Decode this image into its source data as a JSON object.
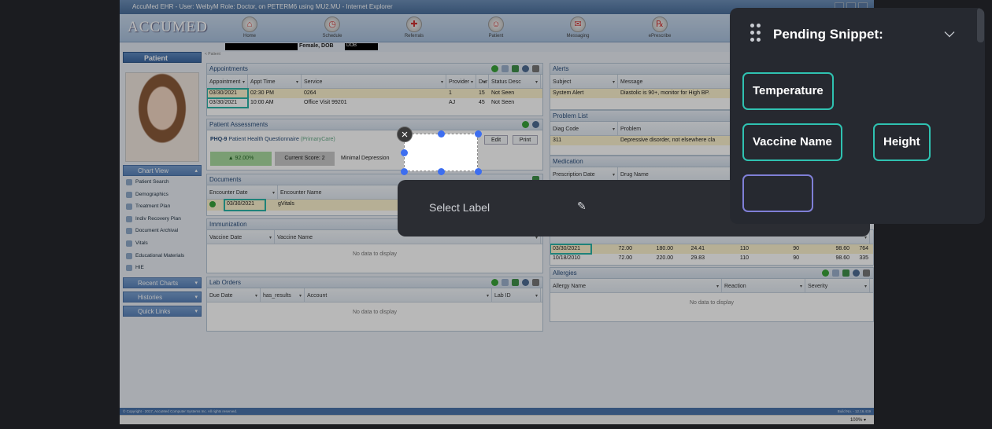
{
  "window_title": "AccuMed EHR - User: WelbyM Role: Doctor, on PETERM6 using MU2.MU - Internet Explorer",
  "logo": "ACCUMED",
  "nav": [
    "Home",
    "Schedule",
    "Referrals",
    "Patient",
    "Messaging",
    "ePrescribe"
  ],
  "patient_bar": {
    "sex_label": "Female, DOB",
    "dob_label": "DOB"
  },
  "breadcrumb": "< Patient",
  "left": {
    "header": "Patient",
    "chart_view": "Chart View",
    "items": [
      "Patient Search",
      "Demographics",
      "Treatment Plan",
      "Indiv Recovery Plan",
      "Document Archival",
      "Vitals",
      "Educational Materials",
      "HIE"
    ],
    "recent_charts": "Recent Charts",
    "histories": "Histories",
    "quick_links": "Quick Links"
  },
  "appointments": {
    "title": "Appointments",
    "columns": [
      "Appointment",
      "Appt Time",
      "Service",
      "Provider",
      "Dur",
      "Status Desc"
    ],
    "rows": [
      [
        "03/30/2021",
        "02:30 PM",
        "0264",
        "1",
        "15",
        "Not Seen"
      ],
      [
        "03/30/2021",
        "10:00 AM",
        "Office Visit 99201",
        "AJ",
        "45",
        "Not Seen"
      ]
    ]
  },
  "assessments": {
    "title": "Patient Assessments",
    "phq_label": "PHQ-9",
    "phq_name": "Patient Health Questionnaire",
    "phq_type": "(PrimaryCare)",
    "edit": "Edit",
    "print": "Print",
    "percent": "▲ 92.00%",
    "score": "Current Score: 2",
    "severity": "Minimal Depression"
  },
  "documents": {
    "title": "Documents",
    "columns": [
      "Encounter Date",
      "Encounter Name"
    ],
    "row": [
      "03/30/2021",
      "gVitals"
    ]
  },
  "immunization": {
    "title": "Immunization",
    "columns": [
      "Vaccine Date",
      "Vaccine Name"
    ],
    "empty": "No data to display"
  },
  "lab_orders": {
    "title": "Lab Orders",
    "columns": [
      "Due Date",
      "has_results",
      "Account",
      "Lab ID"
    ],
    "empty": "No data to display"
  },
  "alerts": {
    "title": "Alerts",
    "columns": [
      "Subject",
      "Message"
    ],
    "row": [
      "System Alert",
      "Diastolic is 90+, monitor for High BP."
    ]
  },
  "problems": {
    "title": "Problem List",
    "columns": [
      "Diag Code",
      "Problem"
    ],
    "row": [
      "311",
      "Depressive disorder, not elsewhere cla"
    ]
  },
  "medication": {
    "title": "Medication",
    "columns": [
      "Prescription Date",
      "Drug Name"
    ]
  },
  "vitals_rows": [
    [
      "03/30/2021",
      "72.00",
      "180.00",
      "24.41",
      "110",
      "90",
      "98.60",
      "764"
    ],
    [
      "10/18/2010",
      "72.00",
      "220.00",
      "29.83",
      "110",
      "90",
      "98.60",
      "335"
    ]
  ],
  "allergies": {
    "title": "Allergies",
    "columns": [
      "Allergy Name",
      "Reaction",
      "Severity"
    ],
    "empty": "No data to display"
  },
  "footer": "© Copyright - 2017, AccuMed Computer Systems Inc. All rights reserved.",
  "build": "Build No. - 12.16.419",
  "zoom": "100%",
  "overlay": {
    "select_label": "Select Label",
    "panel_title": "Pending Snippet:",
    "chips": [
      "Temperature",
      "Vaccine Name",
      "Height"
    ]
  }
}
